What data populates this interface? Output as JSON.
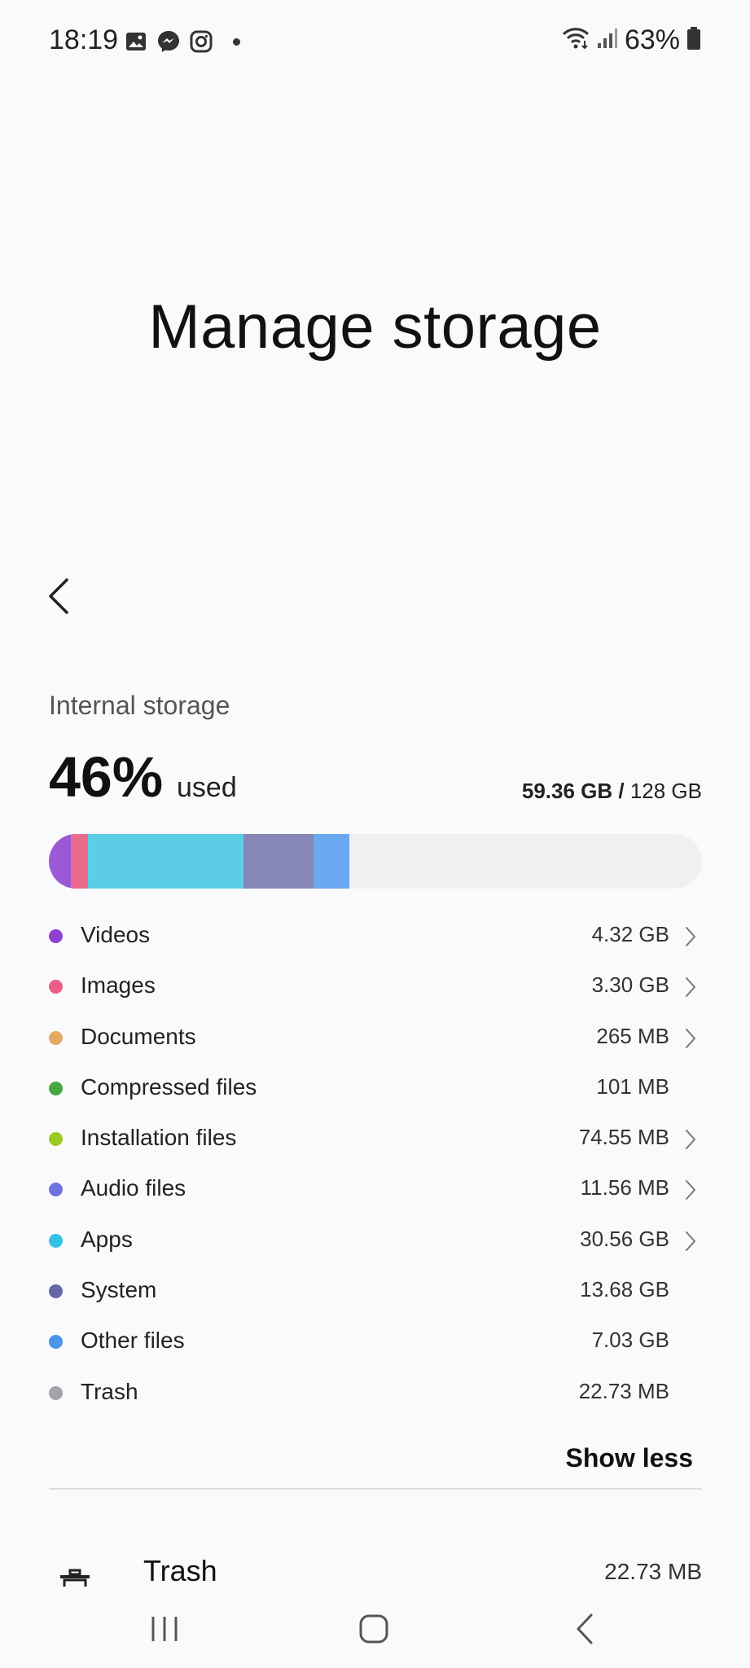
{
  "status_bar": {
    "time": "18:19",
    "battery": "63%",
    "icons": [
      "gallery-icon",
      "messenger-icon",
      "instagram-icon",
      "wifi-icon",
      "signal-icon",
      "battery-icon"
    ]
  },
  "page": {
    "title": "Manage storage"
  },
  "internal_storage": {
    "label": "Internal storage",
    "percent": "46%",
    "used_label": "used",
    "used_amount": "59.36 GB",
    "separator": " / ",
    "total": "128 GB",
    "bar_segments": [
      {
        "name": "Videos",
        "color": "#9b59d6",
        "fraction": 0.0338
      },
      {
        "name": "Images",
        "color": "#ec6a8e",
        "fraction": 0.0258
      },
      {
        "name": "Apps",
        "color": "#5bcee6",
        "fraction": 0.2388
      },
      {
        "name": "System",
        "color": "#8687b6",
        "fraction": 0.1069
      },
      {
        "name": "Other files",
        "color": "#6aa8ef",
        "fraction": 0.0549
      }
    ]
  },
  "categories": [
    {
      "label": "Videos",
      "size": "4.32 GB",
      "color": "#9040d0",
      "chevron": true
    },
    {
      "label": "Images",
      "size": "3.30 GB",
      "color": "#ea5f87",
      "chevron": true
    },
    {
      "label": "Documents",
      "size": "265 MB",
      "color": "#e3ab61",
      "chevron": true
    },
    {
      "label": "Compressed files",
      "size": "101 MB",
      "color": "#46a843",
      "chevron": false
    },
    {
      "label": "Installation files",
      "size": "74.55 MB",
      "color": "#9acb25",
      "chevron": true
    },
    {
      "label": "Audio files",
      "size": "11.56 MB",
      "color": "#7072e0",
      "chevron": true
    },
    {
      "label": "Apps",
      "size": "30.56 GB",
      "color": "#35c1e3",
      "chevron": true
    },
    {
      "label": "System",
      "size": "13.68 GB",
      "color": "#6566a6",
      "chevron": false
    },
    {
      "label": "Other files",
      "size": "7.03 GB",
      "color": "#4a95e8",
      "chevron": false
    },
    {
      "label": "Trash",
      "size": "22.73 MB",
      "color": "#a3a3ad",
      "chevron": false
    }
  ],
  "show_less": "Show less",
  "trash_row": {
    "label": "Trash",
    "size": "22.73 MB"
  }
}
